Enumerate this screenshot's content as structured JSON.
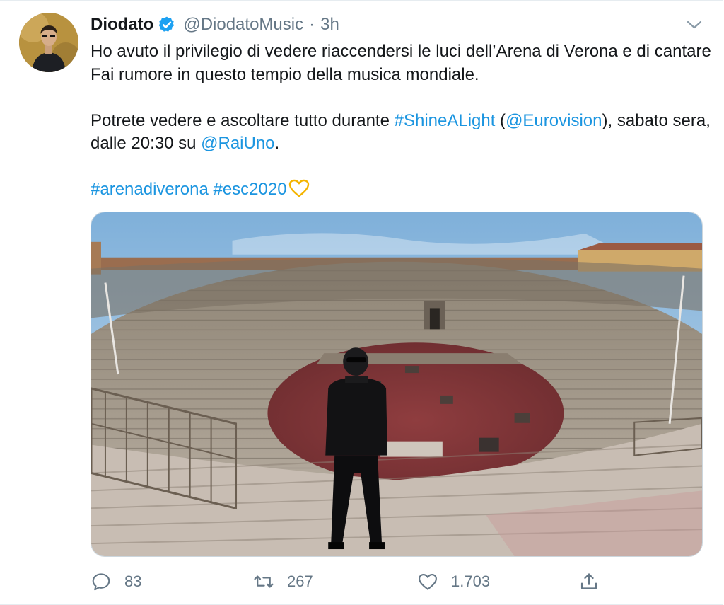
{
  "author": {
    "name": "Diodato",
    "handle": "@DiodatoMusic",
    "separator": "·",
    "time": "3h"
  },
  "tweet": {
    "line1": "Ho avuto il privilegio di vedere riaccendersi le luci dell’Arena di Verona e di cantare Fai rumore in questo tempio della musica mondiale.",
    "p2_before": "Potrete vedere e ascoltare tutto durante ",
    "hashtag_shine": "#ShineALight",
    "p2_paren_open": " (",
    "mention_eurovision": "@Eurovision",
    "p2_paren_close": "),",
    "p2_line2": " sabato sera, dalle 20:30 su ",
    "mention_raiuno": "@RaiUno",
    "p2_end": ".",
    "hashtag_arena": "#arenadiverona",
    "hashtag_esc": "#esc2020"
  },
  "actions": {
    "reply_count": "83",
    "retweet_count": "267",
    "like_count": "1.703"
  },
  "icons": {
    "verified": "verified-badge-icon",
    "caret": "chevron-down-icon",
    "reply": "reply-icon",
    "retweet": "retweet-icon",
    "like": "heart-icon",
    "share": "share-icon",
    "emoji": "yellow-heart-emoji"
  },
  "colors": {
    "link": "#1b95e0",
    "muted": "#657786",
    "text": "#14171a",
    "verified": "#1da1f2"
  }
}
